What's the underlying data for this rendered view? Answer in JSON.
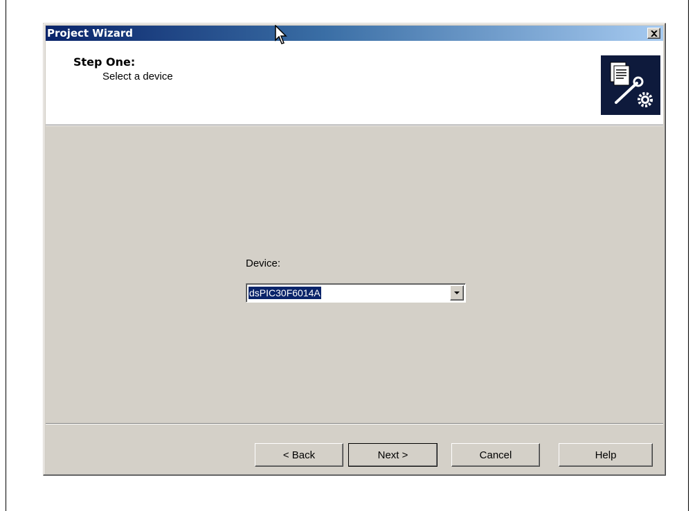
{
  "window": {
    "title": "Project Wizard"
  },
  "header": {
    "step_title": "Step One:",
    "step_subtitle": "Select a device",
    "icon": "wizard-document-tools-icon"
  },
  "form": {
    "device_label": "Device:",
    "device_value": "dsPIC30F6014A"
  },
  "buttons": {
    "back": "< Back",
    "next": "Next >",
    "cancel": "Cancel",
    "help": "Help"
  },
  "colors": {
    "titlebar_start": "#0a246a",
    "titlebar_end": "#a6caf0",
    "dialog_face": "#d4d0c8",
    "selection": "#0a246a"
  }
}
